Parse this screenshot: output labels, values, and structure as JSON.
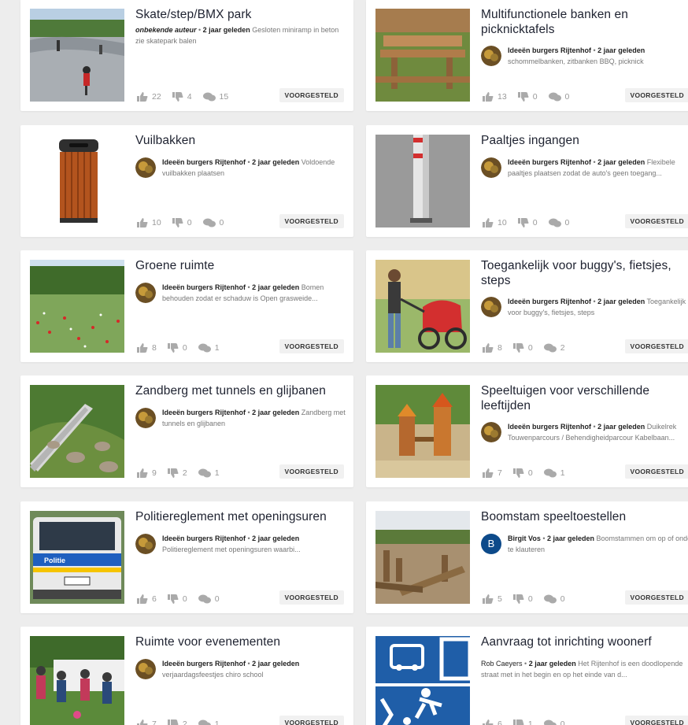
{
  "ideas": [
    {
      "title": "Skate/step/BMX park",
      "author": "onbekende auteur",
      "author_unknown": true,
      "age": "2 jaar geleden",
      "excerpt": "Gesloten miniramp in beton zie skatepark balen",
      "likes": "22",
      "dislikes": "4",
      "comments": "15",
      "status": "VOORGESTELD",
      "avatar": "none",
      "image": "skate-park-photo"
    },
    {
      "title": "Multifunctionele banken en picknicktafels",
      "author": "Ideeën burgers Rijtenhof",
      "age": "2 jaar geleden",
      "excerpt": "schommelbanken, zitbanken BBQ, picknick",
      "likes": "13",
      "dislikes": "0",
      "comments": "0",
      "status": "VOORGESTELD",
      "avatar": "logo",
      "image": "picnic-table-photo"
    },
    {
      "title": "Vuilbakken",
      "author": "Ideeën burgers Rijtenhof",
      "age": "2 jaar geleden",
      "excerpt": "Voldoende vuilbakken plaatsen",
      "likes": "10",
      "dislikes": "0",
      "comments": "0",
      "status": "VOORGESTELD",
      "avatar": "logo",
      "image": "trash-bin-photo"
    },
    {
      "title": "Paaltjes ingangen",
      "author": "Ideeën burgers Rijtenhof",
      "age": "2 jaar geleden",
      "excerpt": "Flexibele paaltjes plaatsen zodat de auto's geen toegang...",
      "likes": "10",
      "dislikes": "0",
      "comments": "0",
      "status": "VOORGESTELD",
      "avatar": "logo",
      "image": "bollard-photo"
    },
    {
      "title": "Groene ruimte",
      "author": "Ideeën burgers Rijtenhof",
      "age": "2 jaar geleden",
      "excerpt": "Bomen behouden zodat er schaduw is Open grasweide...",
      "likes": "8",
      "dislikes": "0",
      "comments": "1",
      "status": "VOORGESTELD",
      "avatar": "logo",
      "image": "meadow-photo"
    },
    {
      "title": "Toegankelijk voor buggy's, fietsjes, steps",
      "author": "Ideeën burgers Rijtenhof",
      "age": "2 jaar geleden",
      "excerpt": "Toegankelijk voor buggy's, fietsjes, steps",
      "likes": "8",
      "dislikes": "0",
      "comments": "2",
      "status": "VOORGESTELD",
      "avatar": "logo",
      "image": "buggy-photo"
    },
    {
      "title": "Zandberg met tunnels en glijbanen",
      "author": "Ideeën burgers Rijtenhof",
      "age": "2 jaar geleden",
      "excerpt": "Zandberg met tunnels en glijbanen",
      "likes": "9",
      "dislikes": "2",
      "comments": "1",
      "status": "VOORGESTELD",
      "avatar": "logo",
      "image": "slide-hill-photo"
    },
    {
      "title": "Speeltuigen voor verschillende leeftijden",
      "author": "Ideeën burgers Rijtenhof",
      "age": "2 jaar geleden",
      "excerpt": "Duikelrek Touwenparcours / Behendigheidparcour Kabelbaan...",
      "likes": "7",
      "dislikes": "0",
      "comments": "1",
      "status": "VOORGESTELD",
      "avatar": "logo",
      "image": "playground-photo"
    },
    {
      "title": "Politiereglement met openingsuren",
      "author": "Ideeën burgers Rijtenhof",
      "age": "2 jaar geleden",
      "excerpt": "Politiereglement met openingsuren waarbi...",
      "likes": "6",
      "dislikes": "0",
      "comments": "0",
      "status": "VOORGESTELD",
      "avatar": "logo",
      "image": "police-van-photo",
      "image_text": "Politie"
    },
    {
      "title": "Boomstam speeltoestellen",
      "author": "Birgit Vos",
      "age": "2 jaar geleden",
      "excerpt": "Boomstammen om op of onder te klauteren",
      "likes": "5",
      "dislikes": "0",
      "comments": "0",
      "status": "VOORGESTELD",
      "avatar": "letter",
      "avatar_letter": "B",
      "image": "tree-trunk-photo"
    },
    {
      "title": "Ruimte voor evenementen",
      "author": "Ideeën burgers Rijtenhof",
      "age": "2 jaar geleden",
      "excerpt": "verjaardagsfeestjes chiro school",
      "likes": "7",
      "dislikes": "2",
      "comments": "1",
      "status": "VOORGESTELD",
      "avatar": "logo",
      "image": "event-photo"
    },
    {
      "title": "Aanvraag tot inrichting woonerf",
      "author": "Rob Caeyers",
      "age": "2 jaar geleden",
      "excerpt": "Het Rijtenhof is een doodlopende straat met in het begin en op het einde van d...",
      "likes": "6",
      "dislikes": "1",
      "comments": "0",
      "status": "VOORGESTELD",
      "avatar": "none",
      "image": "woonerf-sign-photo"
    }
  ],
  "colors": {
    "accent_blue": "#0d4a8a",
    "stat_gray": "#999999",
    "badge_bg": "#f1f1f1"
  }
}
